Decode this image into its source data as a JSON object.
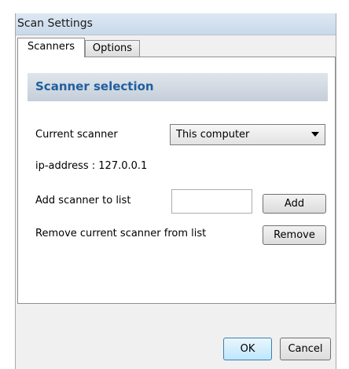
{
  "window": {
    "title": "Scan Settings"
  },
  "tabs": [
    {
      "label": "Scanners",
      "active": true
    },
    {
      "label": "Options",
      "active": false
    }
  ],
  "scanners": {
    "section_title": "Scanner selection",
    "current_scanner_label": "Current scanner",
    "current_scanner_value": "This computer",
    "ip_text": "ip-address : 127.0.0.1",
    "add_label": "Add scanner to list",
    "add_input_value": "",
    "add_button": "Add",
    "remove_label": "Remove current scanner from list",
    "remove_button": "Remove"
  },
  "footer": {
    "ok": "OK",
    "cancel": "Cancel"
  },
  "icons": {
    "dropdown": "chevron-down-icon"
  },
  "colors": {
    "section_title": "#1f5f9f",
    "ok_accent": "#3c7fb1"
  }
}
